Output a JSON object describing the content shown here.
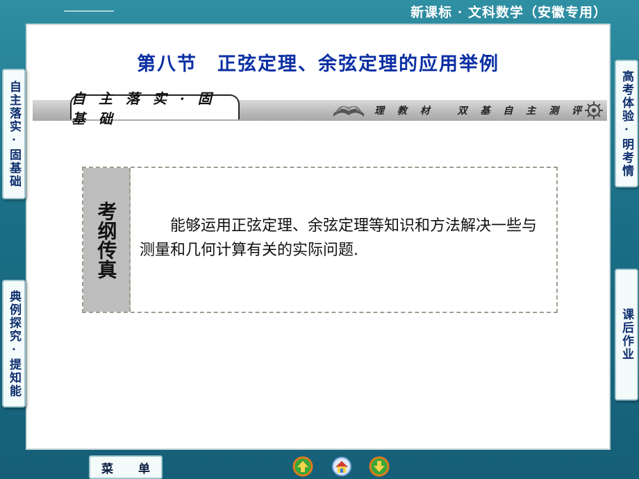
{
  "header": {
    "course_title": "新课标 · 文科数学（安徽专用）"
  },
  "page": {
    "title": "第八节　正弦定理、余弦定理的应用举例"
  },
  "section_bar": {
    "label": "自 主 落 实 · 固 基 础",
    "sub_label": "理 教 材　 双 基 自 主 测 评"
  },
  "syllabus": {
    "label": "考纲传真",
    "text": "能够运用正弦定理、余弦定理等知识和方法解决一些与测量和几何计算有关的实际问题."
  },
  "side_tabs": {
    "left_top": "自主落实·固基础",
    "left_bottom": "典例探究·提知能",
    "right_top": "高考体验·明考情",
    "right_bottom": "课后作业"
  },
  "footer": {
    "menu_left": "菜",
    "menu_right": "单"
  },
  "icons": {
    "prev": "arrow-up-icon",
    "home": "home-icon",
    "next": "arrow-down-icon",
    "book": "book-icon",
    "compass": "compass-icon"
  },
  "colors": {
    "title": "#0b2fa3",
    "frame": "#1b6f86",
    "nav_green": "#3aa63a",
    "nav_orange": "#e07a1a"
  }
}
